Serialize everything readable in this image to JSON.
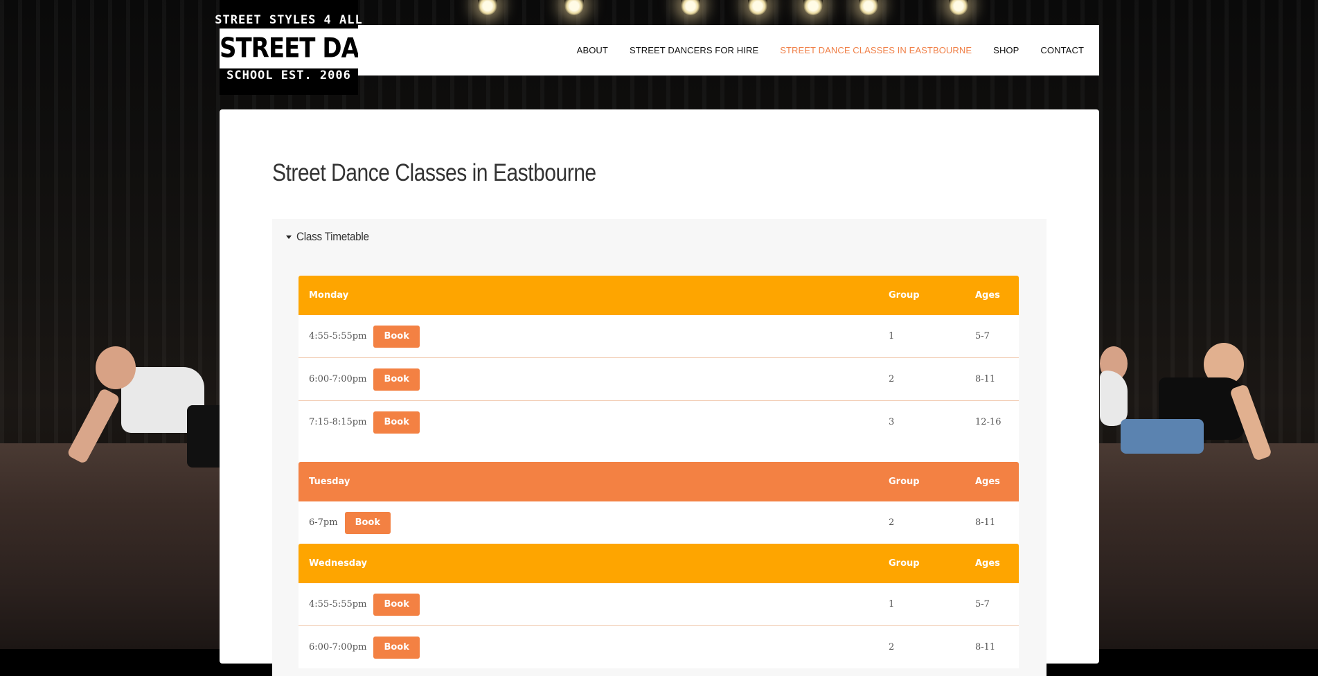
{
  "site": {
    "logo": {
      "line_top": "STREET STYLES 4 ALL",
      "line_mid": "STREET DANCE",
      "line_bottom": "SCHOOL EST. 2006"
    },
    "nav": [
      {
        "label": "ABOUT",
        "active": false
      },
      {
        "label": "STREET DANCERS FOR HIRE",
        "active": false
      },
      {
        "label": "STREET DANCE CLASSES IN EASTBOURNE",
        "active": true
      },
      {
        "label": "SHOP",
        "active": false
      },
      {
        "label": "CONTACT",
        "active": false
      }
    ]
  },
  "colors": {
    "accent": "#f08048",
    "header_yellow": "#fea500",
    "header_orange": "#f38143",
    "button": "#f38143"
  },
  "icons": {
    "accordion": "caret-down-icon"
  },
  "page": {
    "title": "Street Dance Classes in Eastbourne",
    "accordion_label": "Class Timetable"
  },
  "timetable": {
    "book_label": "Book",
    "group_header": "Group",
    "ages_header": "Ages",
    "days": [
      {
        "day": "Monday",
        "classes": [
          {
            "time": "4:55-5:55pm",
            "group": "1",
            "ages": "5-7"
          },
          {
            "time": "6:00-7:00pm",
            "group": "2",
            "ages": "8-11"
          },
          {
            "time": "7:15-8:15pm",
            "group": "3",
            "ages": "12-16"
          }
        ]
      },
      {
        "day": "Tuesday",
        "classes": [
          {
            "time": "6-7pm",
            "group": "2",
            "ages": "8-11"
          }
        ]
      },
      {
        "day": "Wednesday",
        "classes": [
          {
            "time": "4:55-5:55pm",
            "group": "1",
            "ages": "5-7"
          },
          {
            "time": "6:00-7:00pm",
            "group": "2",
            "ages": "8-11"
          }
        ]
      }
    ]
  }
}
